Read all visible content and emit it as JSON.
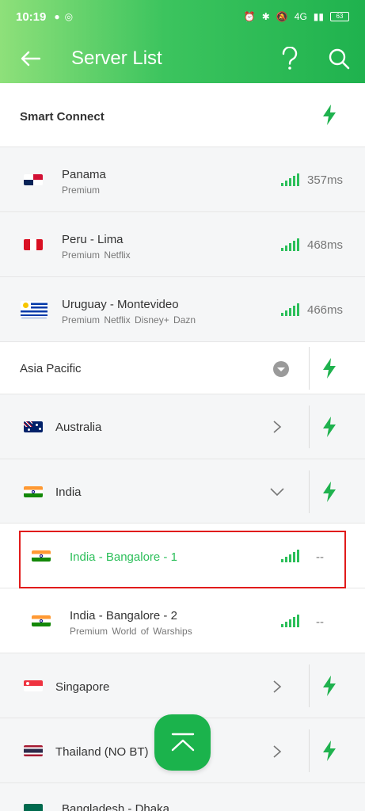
{
  "status_bar": {
    "time": "10:19",
    "network": "4G",
    "battery": "63"
  },
  "toolbar": {
    "title": "Server List"
  },
  "smart_connect": {
    "label": "Smart Connect"
  },
  "favorites": [
    {
      "name": "Panama",
      "sub": "Premium",
      "latency": "357ms"
    },
    {
      "name": "Peru - Lima",
      "sub": "Premium  Netflix",
      "latency": "468ms"
    },
    {
      "name": "Uruguay - Montevideo",
      "sub": "Premium  Netflix  Disney+  Dazn",
      "latency": "466ms"
    }
  ],
  "region": {
    "label": "Asia Pacific"
  },
  "countries": {
    "australia": "Australia",
    "india": "India",
    "singapore": "Singapore",
    "thailand": "Thailand (NO BT)",
    "bangladesh": "Bangladesh - Dhaka"
  },
  "india_servers": [
    {
      "name": "India - Bangalore - 1",
      "sub": "",
      "latency": "--"
    },
    {
      "name": "India - Bangalore - 2",
      "sub": "Premium  World of Warships",
      "latency": "--"
    }
  ],
  "colors": {
    "accent": "#1fb24e",
    "highlight_border": "#e11b1b",
    "selected_text": "#2cbf5a"
  }
}
